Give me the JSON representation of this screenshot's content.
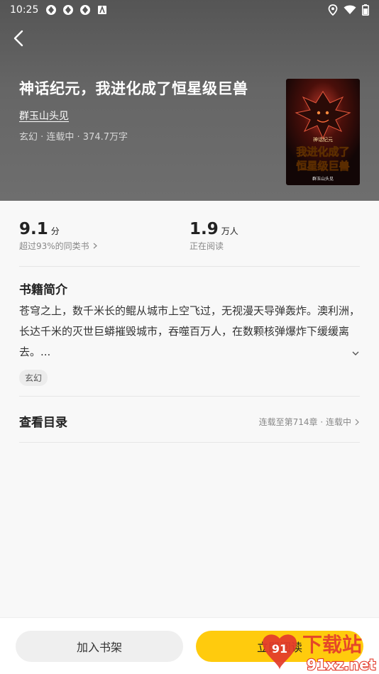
{
  "status_bar": {
    "time": "10:25"
  },
  "book": {
    "title": "神话纪元，我进化成了恒星级巨兽",
    "author": "群玉山头见",
    "meta": "玄幻 · 连载中 · 374.7万字",
    "cover": {
      "series": "神话纪元",
      "line1": "我进化成了",
      "line2": "恒星级巨兽",
      "author": "群玉山头见"
    }
  },
  "stats": {
    "score": {
      "value": "9.1",
      "unit": "分",
      "sub": "超过93%的同类书"
    },
    "readers": {
      "value": "1.9",
      "unit": "万人",
      "sub": "正在阅读"
    }
  },
  "intro": {
    "heading": "书籍简介",
    "text": "苍穹之上，数千米长的鲲从城市上空飞过，无视漫天导弹轰炸。澳利洲，长达千米的灭世巨蟒摧毁城市，吞噬百万人，在数颗核弹爆炸下缓缓离去。...",
    "tag": "玄幻"
  },
  "toc": {
    "label": "查看目录",
    "status": "连载至第714章 · 连载中"
  },
  "actions": {
    "add_shelf": "加入书架",
    "read_now": "立即阅读"
  },
  "watermark": {
    "brand": "下载站",
    "domain": "91xz.net"
  },
  "icons": {
    "back": "back-arrow-icon",
    "chevron_right": "chevron-right-icon",
    "expand": "chevron-down-icon",
    "wifi": "wifi-icon",
    "battery": "battery-icon",
    "location": "location-icon"
  },
  "colors": {
    "accent": "#ffcb0d",
    "hero_bg": "#616161"
  }
}
